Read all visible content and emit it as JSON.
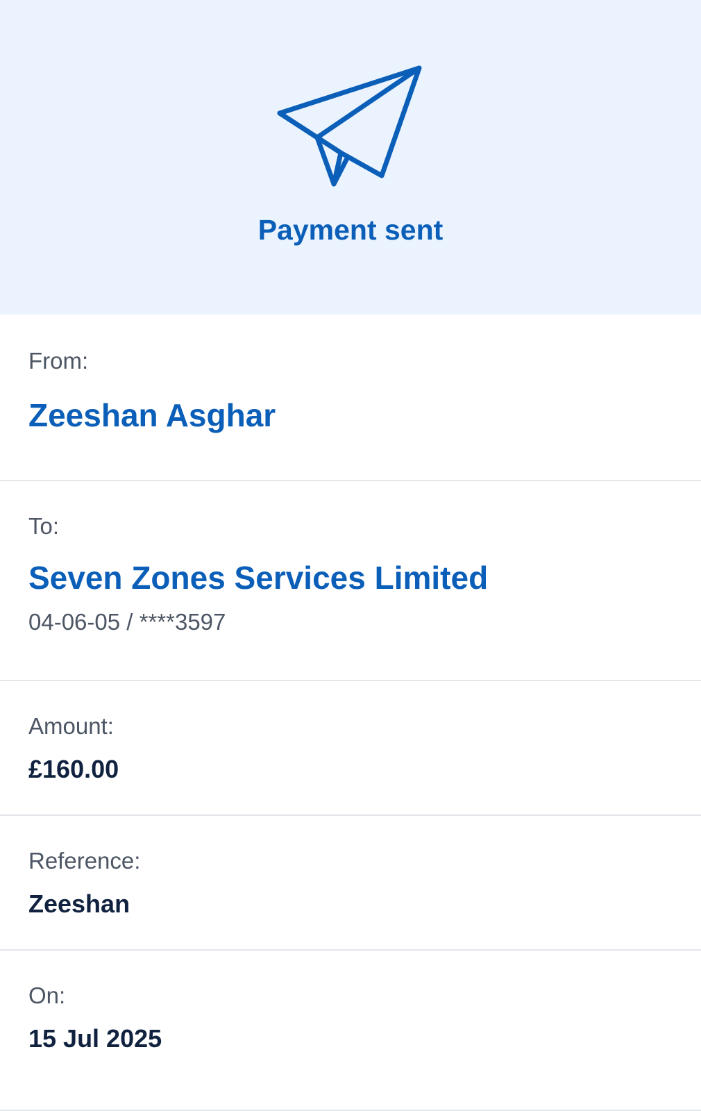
{
  "header": {
    "title": "Payment sent",
    "icon": "paper-plane-icon",
    "accent_color": "#0b5fb8",
    "background_color": "#ebf4fe"
  },
  "from": {
    "label": "From:",
    "name": "Zeeshan Asghar"
  },
  "to": {
    "label": "To:",
    "name": "Seven Zones Services Limited",
    "account": "04-06-05 / ****3597"
  },
  "amount": {
    "label": "Amount:",
    "value": "£160.00"
  },
  "reference": {
    "label": "Reference:",
    "value": "Zeeshan"
  },
  "date": {
    "label": "On:",
    "value": "15 Jul 2025"
  }
}
